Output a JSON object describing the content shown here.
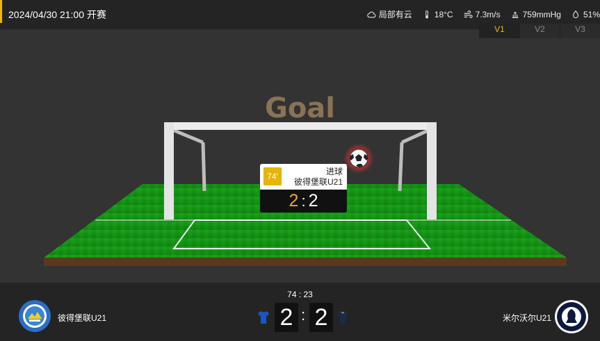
{
  "header": {
    "datetime": "2024/04/30 21:00 开赛",
    "weather": {
      "condition": "局部有云",
      "condition_icon": "cloud-icon",
      "temperature": "18°C",
      "wind": "7.3m/s",
      "pressure": "759mmHg",
      "humidity": "51%"
    }
  },
  "tabs": [
    {
      "label": "V1",
      "active": true
    },
    {
      "label": "V2",
      "active": false
    },
    {
      "label": "V3",
      "active": false
    }
  ],
  "stage": {
    "banner": "Goal",
    "event": {
      "minute": "74'",
      "type": "进球",
      "team": "彼得堡联U21",
      "home_score": "2",
      "separator": ":",
      "away_score": "2"
    }
  },
  "match": {
    "clock": "74 : 23",
    "home": {
      "name": "彼得堡联U21",
      "score": "2",
      "shirt_color": "#1a56c4"
    },
    "away": {
      "name": "米尔沃尔U21",
      "score": "2",
      "shirt_color": "#1b2a4a"
    },
    "separator": ":"
  },
  "colors": {
    "accent": "#f2b705",
    "pitch": "#1e9a1e",
    "goal_text": "#8a7354"
  }
}
